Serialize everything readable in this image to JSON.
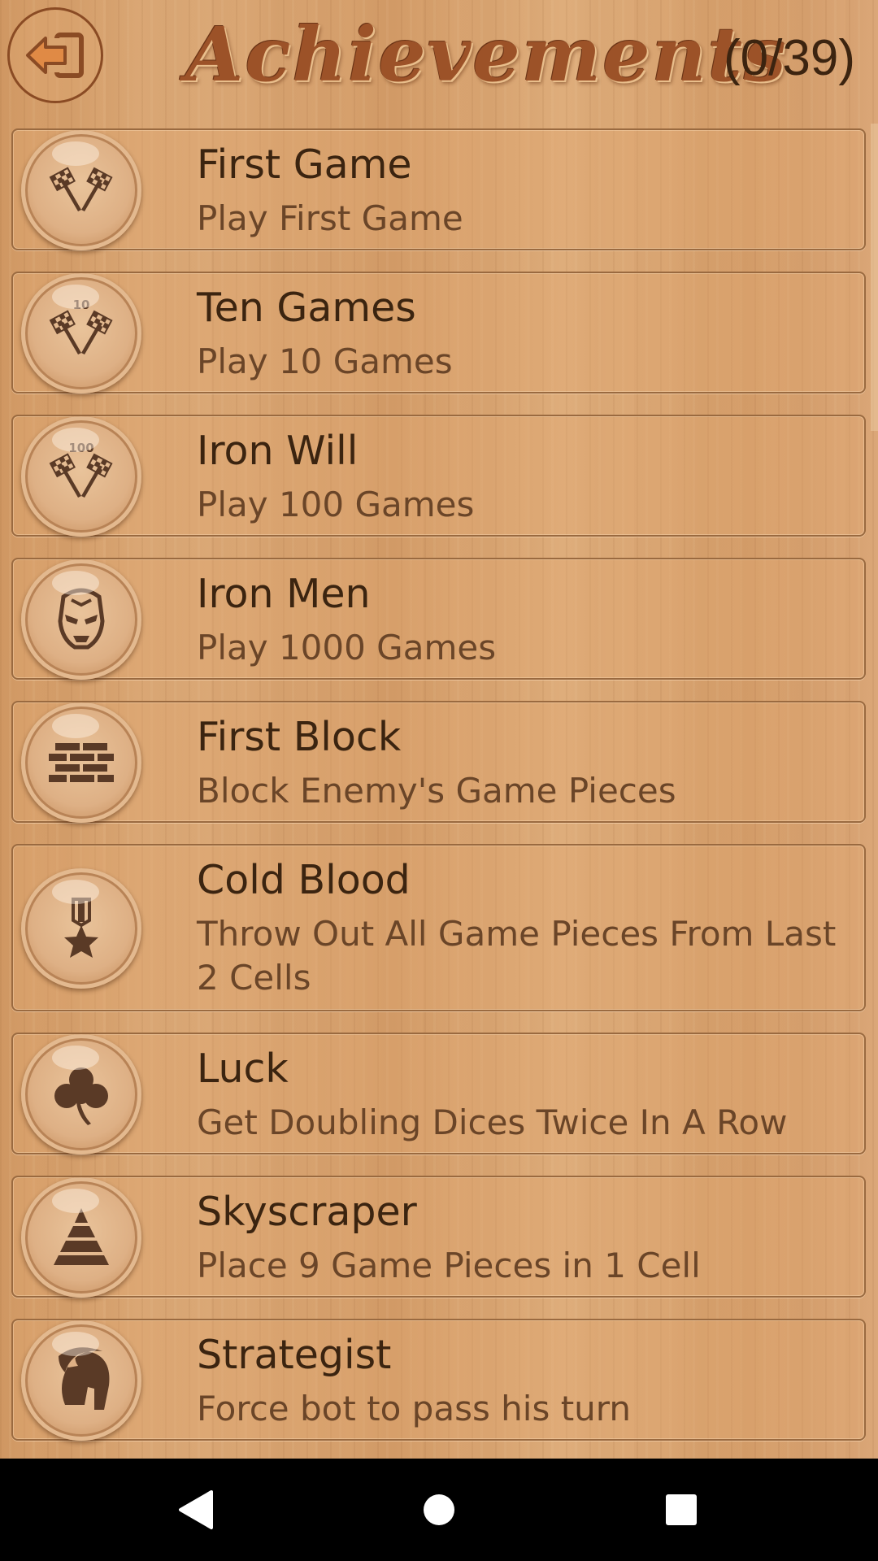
{
  "header": {
    "title": "Achievements",
    "count": "(0/39)",
    "back_icon": "exit-arrow-icon"
  },
  "colors": {
    "wood": "#d7a26f",
    "title": "#9c5228",
    "text_dark": "#3b2410",
    "text_desc": "#6a4528"
  },
  "achievements": [
    {
      "title": "First Game",
      "desc": "Play First Game",
      "icon": "checkered-flags-icon"
    },
    {
      "title": "Ten Games",
      "desc": "Play 10 Games",
      "icon": "checkered-flags-10-icon",
      "icon_label": "10"
    },
    {
      "title": "Iron Will",
      "desc": "Play 100 Games",
      "icon": "checkered-flags-100-icon",
      "icon_label": "100"
    },
    {
      "title": "Iron Men",
      "desc": "Play 1000 Games",
      "icon": "iron-mask-icon"
    },
    {
      "title": "First Block",
      "desc": "Block Enemy's Game Pieces",
      "icon": "brick-wall-icon"
    },
    {
      "title": "Cold Blood",
      "desc": "Throw Out All Game Pieces From Last 2 Cells",
      "icon": "medal-star-icon"
    },
    {
      "title": "Luck",
      "desc": "Get Doubling Dices Twice In A Row",
      "icon": "clover-icon"
    },
    {
      "title": "Skyscraper",
      "desc": "Place 9 Game Pieces in 1 Cell",
      "icon": "pyramid-icon"
    },
    {
      "title": "Strategist",
      "desc": "Force bot to pass his turn",
      "icon": "spartan-helmet-icon"
    }
  ],
  "navbar": {
    "back_icon": "nav-back-icon",
    "home_icon": "nav-home-icon",
    "recents_icon": "nav-recents-icon"
  }
}
